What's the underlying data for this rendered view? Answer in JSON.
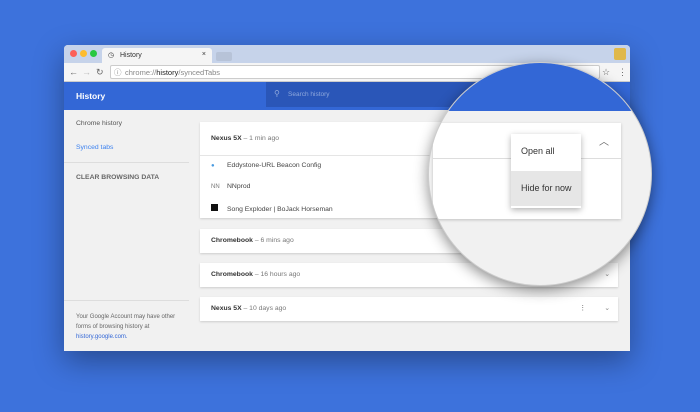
{
  "browser": {
    "tab_title": "History",
    "url_prefix": "chrome://",
    "url_host": "history",
    "url_path": "/syncedTabs"
  },
  "header": {
    "title": "History",
    "search_placeholder": "Search history"
  },
  "sidebar": {
    "items": [
      {
        "label": "Chrome history"
      },
      {
        "label": "Synced tabs"
      }
    ],
    "clear": "CLEAR BROWSING DATA",
    "footer_text": "Your Google Account may have other forms of browsing history at",
    "footer_link": "history.google.com."
  },
  "devices": [
    {
      "name": "Nexus 5X",
      "time": "– 1 min ago",
      "tabs": [
        "Eddystone-URL Beacon Config",
        "NNprod",
        "Song Exploder | BoJack Horseman"
      ]
    },
    {
      "name": "Chromebook",
      "time": "– 6 mins ago"
    },
    {
      "name": "Chromebook",
      "time": "– 16 hours ago"
    },
    {
      "name": "Nexus 5X",
      "time": "– 10 days ago"
    }
  ],
  "menu": {
    "open_all": "Open all",
    "hide": "Hide for now"
  }
}
